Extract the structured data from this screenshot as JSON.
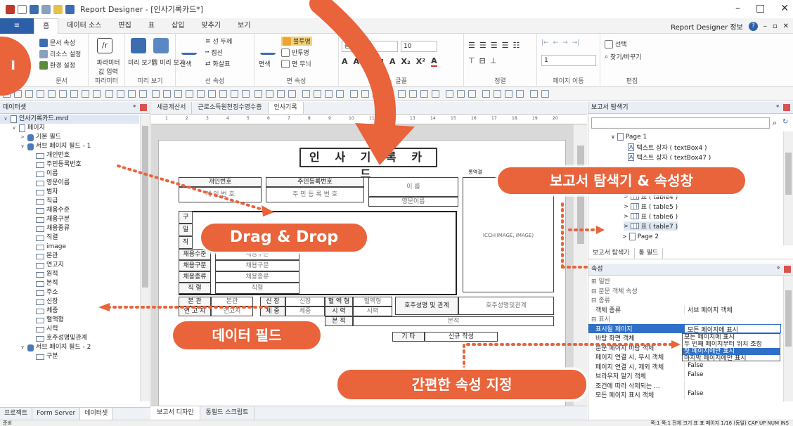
{
  "window": {
    "title": "Report Designer - [인사기록카드*]",
    "min": "–",
    "max": "□",
    "close": "✕"
  },
  "ribbon": {
    "tabs": [
      "",
      "홈",
      "데이터 소스",
      "편집",
      "표",
      "삽입",
      "맞추기",
      "보기"
    ],
    "right_label": "Report Designer 정보",
    "groups": {
      "doc": {
        "label": "문서",
        "items": [
          "문서 속성",
          "리소스 설정",
          "환경 설정"
        ]
      },
      "param": {
        "label": "파라미터",
        "items": [
          "파라미터 값 입력"
        ]
      },
      "preview": {
        "label": "미리 보기",
        "items": [
          "미리 보기",
          "웹 미리 보기"
        ]
      },
      "line": {
        "label": "선 속성",
        "items": [
          "선 두께",
          "점선",
          "화살표",
          "선색"
        ]
      },
      "face": {
        "label": "면 속성",
        "items": [
          "면색",
          "불투명",
          "반투명",
          "면 무늬"
        ]
      },
      "font": {
        "label": "글꼴",
        "font_name": "돋움체",
        "font_size": "10"
      },
      "align": {
        "label": "정렬"
      },
      "pagenav": {
        "label": "페이지 이동",
        "page_value": "1"
      },
      "edit": {
        "label": "편집",
        "items": [
          "선택",
          "찾기/바꾸기"
        ]
      }
    }
  },
  "left_panel": {
    "title": "데이터셋",
    "pin": "ᵠ",
    "tree": [
      {
        "level": 0,
        "icon": "doc",
        "arrow": "v",
        "label": "인사기록카드.mrd"
      },
      {
        "level": 1,
        "icon": "doc",
        "arrow": "v",
        "label": "페이지"
      },
      {
        "level": 2,
        "icon": "db",
        "arrow": ">",
        "label": "기본 필드"
      },
      {
        "level": 2,
        "icon": "db",
        "arrow": "v",
        "label": "서브 페이지 필드 - 1"
      },
      {
        "level": 3,
        "icon": "field",
        "label": "개인번호"
      },
      {
        "level": 3,
        "icon": "field",
        "label": "주민등록번호"
      },
      {
        "level": 3,
        "icon": "field",
        "label": "이름"
      },
      {
        "level": 3,
        "icon": "field",
        "label": "영문이름"
      },
      {
        "level": 3,
        "icon": "field",
        "label": "범자"
      },
      {
        "level": 3,
        "icon": "field",
        "label": "직급"
      },
      {
        "level": 3,
        "icon": "field",
        "label": "채용수준"
      },
      {
        "level": 3,
        "icon": "field",
        "label": "채용구분"
      },
      {
        "level": 3,
        "icon": "field",
        "label": "채용종류"
      },
      {
        "level": 3,
        "icon": "field",
        "label": "직렬"
      },
      {
        "level": 3,
        "icon": "field",
        "label": "image"
      },
      {
        "level": 3,
        "icon": "field",
        "label": "본관"
      },
      {
        "level": 3,
        "icon": "field",
        "label": "연고지"
      },
      {
        "level": 3,
        "icon": "field",
        "label": "원적"
      },
      {
        "level": 3,
        "icon": "field",
        "label": "본적"
      },
      {
        "level": 3,
        "icon": "field",
        "label": "주소"
      },
      {
        "level": 3,
        "icon": "field",
        "label": "신장"
      },
      {
        "level": 3,
        "icon": "field",
        "label": "체중"
      },
      {
        "level": 3,
        "icon": "field",
        "label": "혈액형"
      },
      {
        "level": 3,
        "icon": "field",
        "label": "시력"
      },
      {
        "level": 3,
        "icon": "field",
        "label": "호주성명및관계"
      },
      {
        "level": 2,
        "icon": "db",
        "arrow": "v",
        "label": "서브 페이지 필드 - 2"
      },
      {
        "level": 3,
        "icon": "field",
        "label": "구분"
      }
    ],
    "bottom_tabs": [
      "프로젝트",
      "Form Server",
      "데이터셋"
    ]
  },
  "center": {
    "doc_tabs": [
      "세금계산서",
      "근로소득원천징수영수증",
      "인사기록"
    ],
    "design_tabs": [
      "보고서 디자인",
      "통필드 스크립트"
    ],
    "ruler": [
      "1",
      "2",
      "3",
      "4",
      "5",
      "6",
      "7",
      "8",
      "9",
      "10",
      "11",
      "12",
      "13",
      "14",
      "15",
      "16",
      "17",
      "18",
      "19",
      "20"
    ],
    "form": {
      "title": "인 사 기 록 카 드",
      "header_right": "통역결",
      "cells": [
        {
          "t": "개인번호",
          "c": "lbl"
        },
        {
          "t": "주민등록번호",
          "c": "lbl"
        },
        {
          "t": "이 름",
          "c": "g"
        },
        {
          "t": "계 인 번 호",
          "c": "g"
        },
        {
          "t": "주 민 등 록 번 호",
          "c": "g"
        },
        {
          "t": "영문이름",
          "c": "g"
        },
        {
          "t": "구",
          "c": "lbl"
        },
        {
          "t": "일",
          "c": "lbl"
        },
        {
          "t": "직",
          "c": "lbl"
        },
        {
          "t": "채용수준",
          "c": "lbl"
        },
        {
          "t": "채용구분",
          "c": "lbl"
        },
        {
          "t": "채용종류",
          "c": "lbl"
        },
        {
          "t": "직 렬",
          "c": "lbl"
        },
        {
          "t": "채용수준",
          "c": "g"
        },
        {
          "t": "채용구분",
          "c": "g"
        },
        {
          "t": "채용종류",
          "c": "g"
        },
        {
          "t": "직렬",
          "c": "g"
        },
        {
          "t": "본 관",
          "c": "lbl"
        },
        {
          "t": "연 고 지",
          "c": "lbl"
        },
        {
          "t": "본관",
          "c": "g"
        },
        {
          "t": "연고지",
          "c": "g"
        },
        {
          "t": "신 장",
          "c": "lbl"
        },
        {
          "t": "체 중",
          "c": "lbl"
        },
        {
          "t": "신장",
          "c": "g"
        },
        {
          "t": "체중",
          "c": "g"
        },
        {
          "t": "혈 액 형",
          "c": "lbl"
        },
        {
          "t": "시 력",
          "c": "lbl"
        },
        {
          "t": "혈액형",
          "c": "g"
        },
        {
          "t": "시력",
          "c": "g"
        },
        {
          "t": "호주성명 및 관계",
          "c": "lbl"
        },
        {
          "t": "호주성명및관계",
          "c": "g"
        },
        {
          "t": "본 적",
          "c": "lbl"
        },
        {
          "t": "본적",
          "c": "g"
        },
        {
          "t": "기 타",
          "c": "lbl"
        },
        {
          "t": "신규 작성",
          "c": ""
        }
      ],
      "photo": "ICCH(IMAGE, IMAGE)"
    }
  },
  "right_panel": {
    "explorer_title": "보고서 탐색기",
    "explorer_tree": [
      {
        "label": "Page 1",
        "icon": "doc",
        "arrow": "v"
      },
      {
        "label": "텍스트 상자 ( textBox4 )",
        "icon": "text"
      },
      {
        "label": "텍스트 상자 ( textBox47 )",
        "icon": "text"
      },
      {
        "label": "표 ( table4 )",
        "icon": "table",
        "arrow": ">"
      },
      {
        "label": "표 ( table5 )",
        "icon": "table",
        "arrow": ">"
      },
      {
        "label": "표 ( table6 )",
        "icon": "table",
        "arrow": ">"
      },
      {
        "label": "표 ( table7 )",
        "icon": "table",
        "arrow": ">"
      },
      {
        "label": "Page 2",
        "icon": "doc",
        "arrow": ">"
      }
    ],
    "explorer_tabs": [
      "보고서 탐색기",
      "통 필드"
    ],
    "props_title": "속성",
    "props": [
      {
        "k": "⊞ 일반",
        "v": "",
        "sec": true
      },
      {
        "k": "⊟ 분문 객체 속성",
        "v": "",
        "sec": true
      },
      {
        "k": "⊟ 종류",
        "v": "",
        "sec": true
      },
      {
        "k": "객체 종류",
        "v": "서브 페이지 객체"
      },
      {
        "k": "⊟ 표시",
        "v": "",
        "sec": true
      },
      {
        "k": "표시될 페이지",
        "v": "모든 페이지에 표시",
        "sel": true
      },
      {
        "k": "바탕 화면 객체",
        "v": ""
      },
      {
        "k": "분문 페이지 바탕 객체",
        "v": ""
      },
      {
        "k": "페이지 연결 시, 무시 객체",
        "v": ""
      },
      {
        "k": "페이지 연결 시, 제외 객체",
        "v": "False"
      },
      {
        "k": "브라우저 말기 객체",
        "v": "False"
      },
      {
        "k": "조건에 따라 삭제되는 ...",
        "v": ""
      },
      {
        "k": "모든 페이지 표시 객체",
        "v": "False"
      }
    ],
    "dropdown": [
      "모든 페이지에 표시",
      "두 번째 페이지부터 위치 조정",
      "첫 페이지에만 표시",
      "마지막 페이지에만 표시"
    ]
  },
  "statusbar": {
    "left": "준비",
    "right": "쪽:1 쪽:1   전체 크기 표   표   페이지 1/16 (동일)   CAP  UP  NUM  INS"
  },
  "callouts": {
    "drag": "Drag & Drop",
    "explorer": "보고서 탐색기 & 속성창",
    "fields": "데이터 필드",
    "props": "간편한 속성 지정",
    "home_marker": "I"
  },
  "colors": {
    "accent": "#e9633b",
    "ribbon_file": "#2b5fa8",
    "selection": "#2f6fc7"
  }
}
